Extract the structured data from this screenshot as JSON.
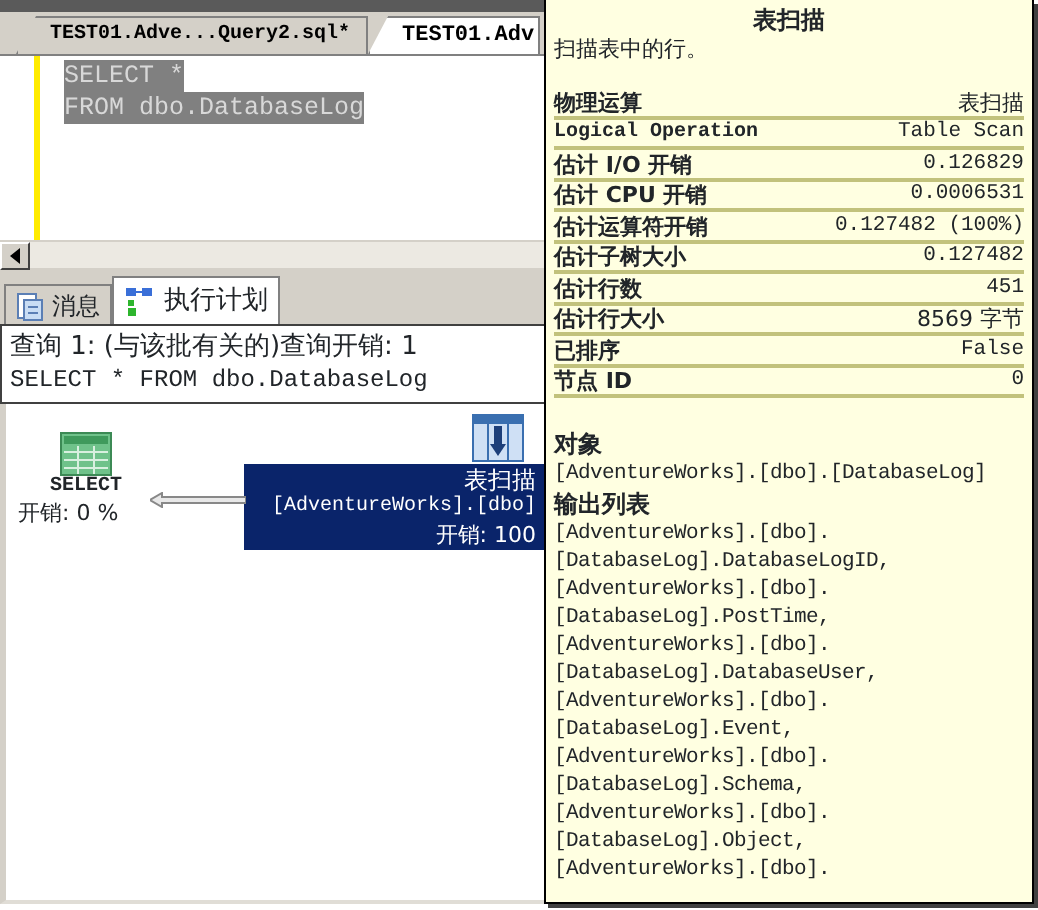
{
  "editor_tabs": [
    {
      "label": "TEST01.Adve...Query2.sql*",
      "selected": false
    },
    {
      "label": "TEST01.Adv",
      "selected": true
    }
  ],
  "editor": {
    "lines": [
      "SELECT *",
      "FROM dbo.DatabaseLog"
    ],
    "selected": true
  },
  "result_tabs": [
    {
      "kind": "messages",
      "label": "消息",
      "selected": false
    },
    {
      "kind": "plan",
      "label": "执行计划",
      "selected": true
    }
  ],
  "plan": {
    "header": [
      "查询 1: (与该批有关的)查询开销: 1",
      "SELECT * FROM dbo.DatabaseLog"
    ],
    "nodes": [
      {
        "kind": "select",
        "label": "SELECT",
        "cost": "开销: 0 %",
        "selected": false
      },
      {
        "kind": "table_scan",
        "label": "表扫描",
        "object": "[AdventureWorks].[dbo]",
        "cost": "开销: 100",
        "selected": true
      }
    ]
  },
  "tooltip": {
    "title": "表扫描",
    "description": "扫描表中的行。",
    "properties": [
      {
        "name": "物理运算",
        "value": "表扫描"
      },
      {
        "name": "Logical Operation",
        "value": "Table Scan"
      },
      {
        "name": "估计 I/O 开销",
        "value": "0.126829"
      },
      {
        "name": "估计 CPU 开销",
        "value": "0.0006531"
      },
      {
        "name": "估计运算符开销",
        "value": "0.127482 (100%)"
      },
      {
        "name": "估计子树大小",
        "value": "0.127482"
      },
      {
        "name": "估计行数",
        "value": "451"
      },
      {
        "name": "估计行大小",
        "value": "8569 字节"
      },
      {
        "name": "已排序",
        "value": "False"
      },
      {
        "name": "节点 ID",
        "value": "0"
      }
    ],
    "sections": [
      {
        "heading": "对象",
        "lines": [
          "[AdventureWorks].[dbo].[DatabaseLog]"
        ]
      },
      {
        "heading": "输出列表",
        "lines": [
          "[AdventureWorks].[dbo].",
          "[DatabaseLog].DatabaseLogID,",
          "[AdventureWorks].[dbo].",
          "[DatabaseLog].PostTime,",
          "[AdventureWorks].[dbo].",
          "[DatabaseLog].DatabaseUser,",
          "[AdventureWorks].[dbo].",
          "[DatabaseLog].Event,",
          "[AdventureWorks].[dbo].",
          "[DatabaseLog].Schema,",
          "[AdventureWorks].[dbo].",
          "[DatabaseLog].Object,",
          "[AdventureWorks].[dbo]."
        ]
      }
    ]
  }
}
